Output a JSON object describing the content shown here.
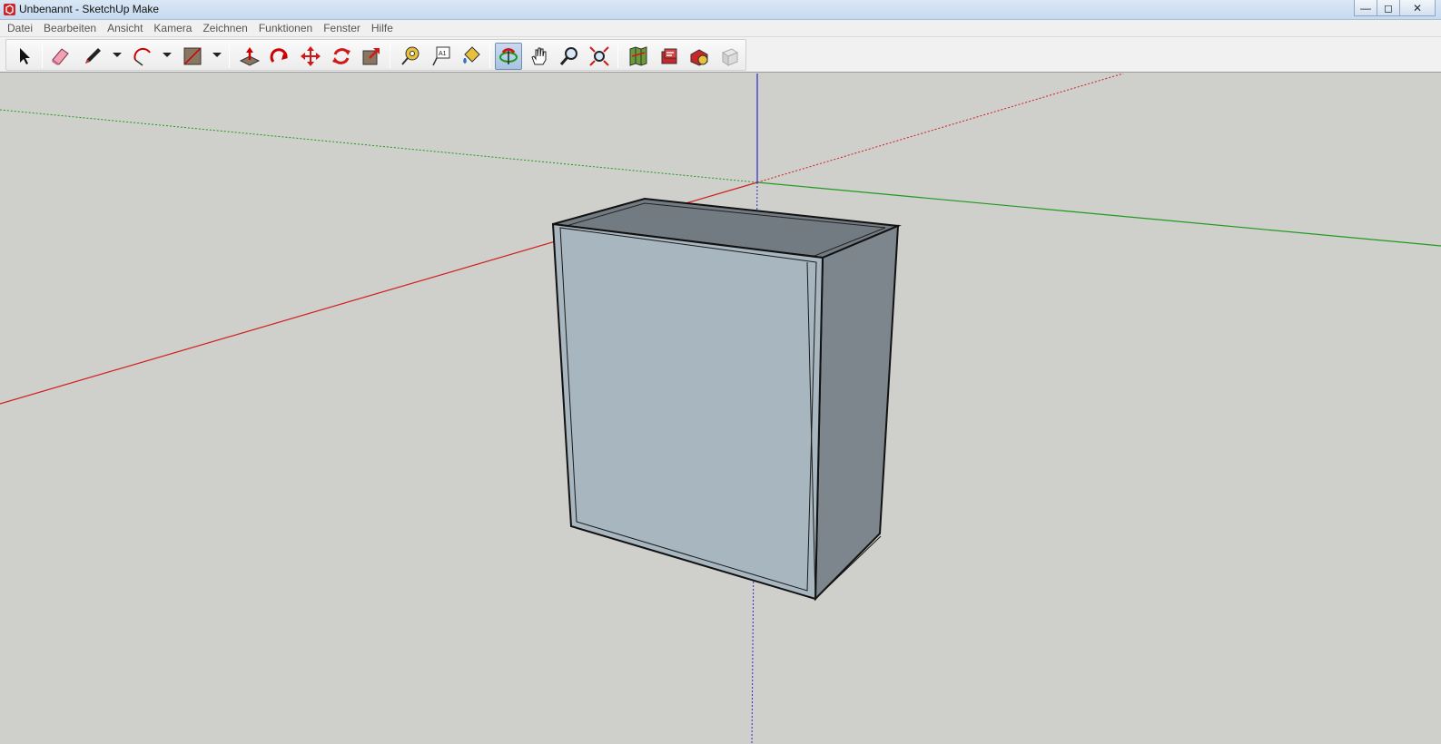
{
  "window": {
    "title": "Unbenannt - SketchUp Make",
    "controls": {
      "minimize": "—",
      "maximize": "◻",
      "close": "✕"
    }
  },
  "menu": {
    "items": [
      "Datei",
      "Bearbeiten",
      "Ansicht",
      "Kamera",
      "Zeichnen",
      "Funktionen",
      "Fenster",
      "Hilfe"
    ]
  },
  "toolbar": {
    "tools": [
      "select-icon",
      "eraser-icon",
      "pencil-icon",
      "arc-icon",
      "rectangle-icon",
      "push-pull-icon",
      "follow-me-icon",
      "move-icon",
      "rotate-icon",
      "scale-icon",
      "tape-measure-icon",
      "text-label-icon",
      "paint-bucket-icon",
      "orbit-icon",
      "pan-icon",
      "zoom-icon",
      "zoom-extents-icon",
      "warehouse-icon",
      "extension-warehouse-icon",
      "share-model-icon",
      "layout-icon"
    ],
    "active_tool": "orbit-icon",
    "text_tool_glyph": "A1"
  },
  "colors": {
    "background": "#cfcfcb",
    "axis_red": "#d21e1e",
    "axis_green": "#1f9a1f",
    "axis_blue": "#2a2acc",
    "box_front": "#a8b6c0",
    "box_side": "#7d868c",
    "box_top": "#737b82",
    "edge": "#111111"
  }
}
